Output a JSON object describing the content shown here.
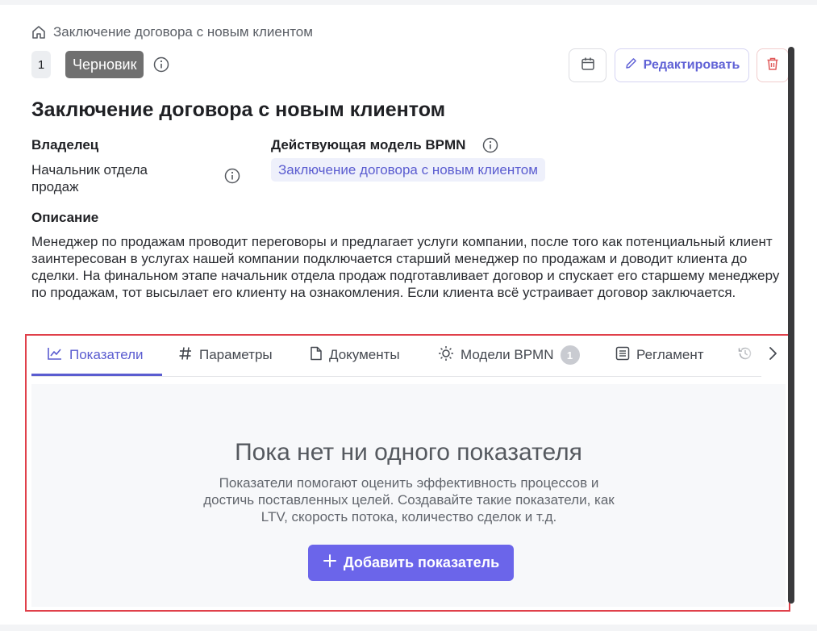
{
  "breadcrumb": {
    "icon": "home-icon",
    "text": "Заключение договора с новым клиентом"
  },
  "header": {
    "version": "1",
    "status": "Черновик",
    "edit_label": "Редактировать",
    "accent_color": "#6062d6",
    "status_color": "#707070",
    "delete_color": "#e05a5a"
  },
  "process": {
    "title": "Заключение договора с новым клиентом",
    "owner_label": "Владелец",
    "owner_value": "Начальник отдела продаж",
    "model_label": "Действующая модель BPMN",
    "model_value": "Заключение договора с новым клиентом",
    "description_label": "Описание",
    "description": "Менеджер по продажам проводит переговоры и предлагает услуги компании, после того как потенциальный клиент заинтересован в услугах нашей компании подключается старший менеджер по продажам и доводит клиента до сделки. На финальном этапе начальник отдела продаж подготавливает договор и спускает его старшему менеджеру по продажам, тот высылает его клиенту на ознакомления. Если клиента всё устраивает договор заключается."
  },
  "tabs": [
    {
      "label": "Показатели",
      "icon": "chart-line-icon",
      "active": true
    },
    {
      "label": "Параметры",
      "icon": "hash-icon",
      "active": false
    },
    {
      "label": "Документы",
      "icon": "document-icon",
      "active": false
    },
    {
      "label": "Модели BPMN",
      "icon": "sun-icon",
      "active": false,
      "count": "1"
    },
    {
      "label": "Регламент",
      "icon": "list-icon",
      "active": false
    },
    {
      "label": "",
      "icon": "history-icon",
      "active": false
    }
  ],
  "empty_state": {
    "title": "Пока нет ни одного показателя",
    "description": "Показатели помогают оценить эффективность процессов и достичь поставленных целей. Создавайте такие показатели, как LTV, скорость потока, количество сделок и т.д.",
    "add_label": "Добавить показатель"
  }
}
